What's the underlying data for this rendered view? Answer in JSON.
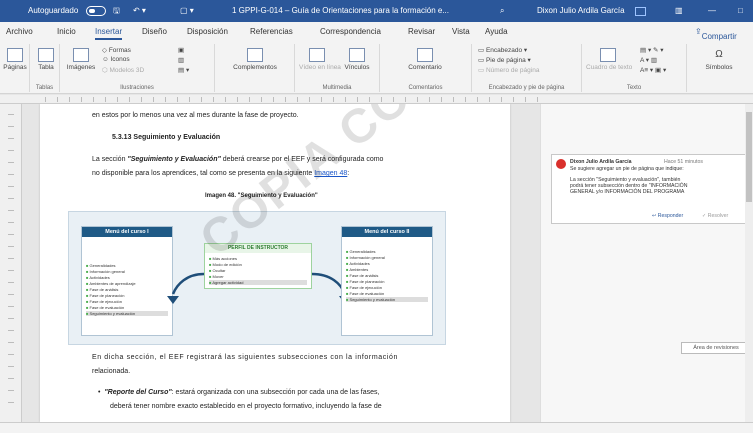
{
  "titlebar": {
    "autosave_label": "Autoguardado",
    "doc_title": "1 GPPI-G-014 – Guía de Orientaciones para la formación e...",
    "user_name": "Dixon Julio Ardila García",
    "bg": "#2b579a"
  },
  "tabs": [
    "Archivo",
    "Inicio",
    "Insertar",
    "Diseño",
    "Disposición",
    "Referencias",
    "Correspondencia",
    "Revisar",
    "Vista",
    "Ayuda"
  ],
  "share_label": "Compartir",
  "ribbon": {
    "paginas": "Páginas",
    "tabla": "Tabla",
    "tablas_group": "Tablas",
    "imagenes": "Imágenes",
    "formas": "Formas",
    "iconos": "Iconos",
    "modelos3d": "Modelos 3D",
    "ilustraciones_group": "Ilustraciones",
    "complementos": "Complementos",
    "video": "Vídeo en línea",
    "multimedia_group": "Multimedia",
    "vinculos": "Vínculos",
    "comentario": "Comentario",
    "comentarios_group": "Comentarios",
    "encabezado": "Encabezado",
    "pie": "Pie de página",
    "numero": "Número de página",
    "enc_group": "Encabezado y pie de página",
    "cuadro": "Cuadro de texto",
    "texto_group": "Texto",
    "simbolos": "Símbolos"
  },
  "document": {
    "line1": "en estos por lo menos una vez al mes durante la fase de proyecto.",
    "heading": "5.3.13 Seguimiento y Evaluación",
    "p1_a": "La sección ",
    "p1_b": "\"Seguimiento y Evaluación\"",
    "p1_c": " deberá crearse por el EEF y será configurada como",
    "p2_a": "no disponible para los aprendices, tal como se presenta en la siguiente ",
    "p2_link": "Imagen 48",
    "p2_c": ":",
    "caption": "Imagen 48. \"Seguimiento y Evaluación\"",
    "p3": "En dicha sección, el EEF registrará las siguientes subsecciones con la información",
    "p3b": "relacionada.",
    "bullet_a": "\"Reporte del Curso\"",
    "bullet_b": ": estará organizada con una subsección por cada una de las fases,",
    "p4": "deberá tener nombre exacto establecido en el proyecto formativo, incluyendo la fase de",
    "watermark": "COPIA CONTROLADA"
  },
  "figure": {
    "left_title": "Menú del curso I",
    "right_title": "Menú del curso II",
    "center_title": "PERFIL DE INSTRUCTOR",
    "left_items": [
      "Generalidades",
      "Información general",
      "Actividades",
      "Ambientes de aprendizaje",
      "Fase de análisis",
      "Fase de planeación",
      "Fase de ejecución",
      "Fase de evaluación",
      "Seguimiento y evaluación"
    ],
    "right_items": [
      "Generalidades",
      "Información general",
      "Actividades",
      "Ambientes",
      "Fase de análisis",
      "Fase de planeación",
      "Fase de ejecución",
      "Fase de evaluación",
      "Seguimiento y evaluación"
    ],
    "center_items": [
      "Más acciones",
      "Modo de edición",
      "Ocultar",
      "Mover",
      "Agregar actividad"
    ]
  },
  "comment": {
    "author": "Dixon Julio Ardila García",
    "time": "Hace 51 minutos",
    "line1": "Se sugiere agregar un pie de página que indique:",
    "line2": "La sección \"Seguimiento y evaluación\", también",
    "line3": "podrá tener subsección dentro de \"INFORMACIÓN",
    "line4": "GENERAL y/o INFORMACIÓN DEL PROGRAMA",
    "reply": "Responder",
    "resolve": "Resolver"
  },
  "review_pane_btn": "Área de revisiones"
}
